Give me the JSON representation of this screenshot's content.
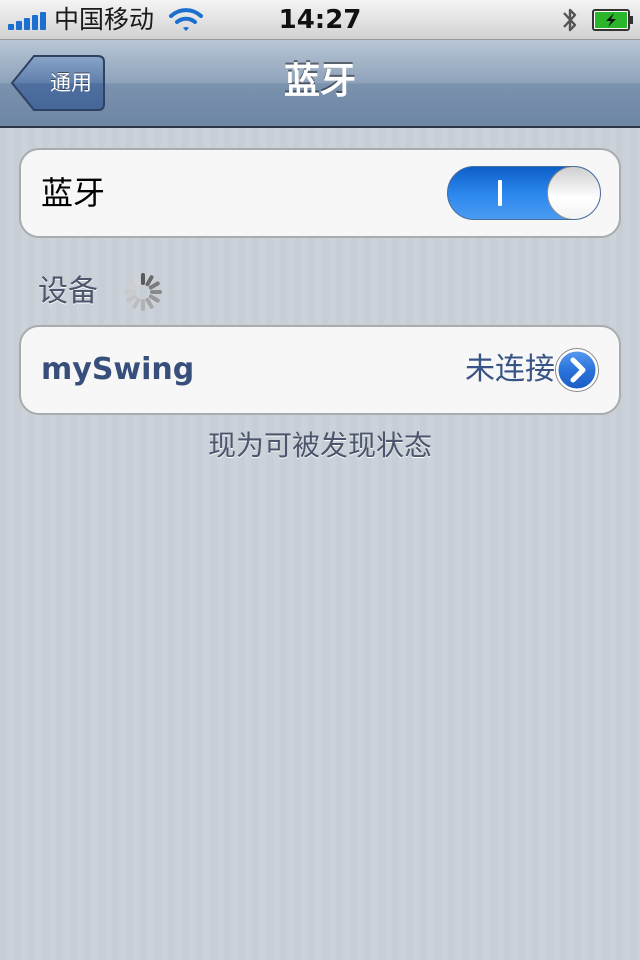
{
  "status_bar": {
    "carrier": "中国移动",
    "time": "14:27",
    "icons": [
      "signal-bars-icon",
      "wifi-icon",
      "bluetooth-icon",
      "battery-charging-icon"
    ],
    "battery_color": "#2ab52a"
  },
  "nav": {
    "back_label": "通用",
    "title": "蓝牙"
  },
  "bluetooth_cell": {
    "label": "蓝牙",
    "toggle_state": "on",
    "toggle_on_label": "I"
  },
  "devices": {
    "header": "设备",
    "searching_indicator": "spinner-icon",
    "items": [
      {
        "name": "mySwing",
        "status": "未连接",
        "accessory": "detail-disclosure-icon"
      }
    ]
  },
  "footer_note": "现为可被发现状态",
  "colors": {
    "toggle_on": "#2b86ec",
    "device_name": "#384f7c",
    "device_status": "#385487",
    "nav_bar": "#6d86a5"
  }
}
